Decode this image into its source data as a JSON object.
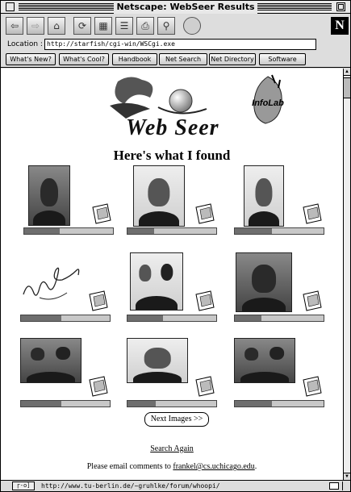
{
  "window": {
    "title": "Netscape: WebSeer Results"
  },
  "toolbar": {
    "buttons": [
      {
        "name": "back-icon",
        "glyph": "⇦"
      },
      {
        "name": "forward-icon",
        "glyph": "⇨"
      },
      {
        "name": "home-icon",
        "glyph": "⌂"
      },
      {
        "name": "reload-icon",
        "glyph": "⟳"
      },
      {
        "name": "images-icon",
        "glyph": "▦"
      },
      {
        "name": "open-icon",
        "glyph": "☰"
      },
      {
        "name": "print-icon",
        "glyph": "⎙"
      },
      {
        "name": "find-icon",
        "glyph": "⚲"
      },
      {
        "name": "stop-icon",
        "glyph": ""
      }
    ],
    "brand_letter": "N"
  },
  "location": {
    "label": "Location :",
    "url": "http://starfish/cgi-win/WSCgi.exe"
  },
  "directory": {
    "whats_new": "What's New?",
    "whats_cool": "What's Cool?",
    "handbook": "Handbook",
    "net_search": "Net Search",
    "net_directory": "Net Directory",
    "software": "Software"
  },
  "page": {
    "logo_text": "Web Seer",
    "infolab_text": "InfoLab",
    "heading": "Here's what I found",
    "results": [
      {
        "kind": "portrait-dark",
        "relevance": 0.4
      },
      {
        "kind": "portrait-light",
        "relevance": 0.3
      },
      {
        "kind": "portrait-light",
        "relevance": 0.42
      },
      {
        "kind": "signature",
        "relevance": 0.45
      },
      {
        "kind": "group",
        "relevance": 0.4
      },
      {
        "kind": "portrait-dark",
        "relevance": 0.3
      },
      {
        "kind": "group",
        "relevance": 0.45
      },
      {
        "kind": "portrait-light",
        "relevance": 0.32
      },
      {
        "kind": "group",
        "relevance": 0.42
      }
    ],
    "next_button": "Next Images >>",
    "search_again": "Search Again",
    "comments_prefix": "Please email comments to ",
    "comments_email": "frankel@cs.uchicago.edu",
    "comments_suffix": "."
  },
  "status": {
    "security": "ɼ-o]",
    "text": "http://www.tu-berlin.de/~gruhlke/forum/whoopi/"
  }
}
